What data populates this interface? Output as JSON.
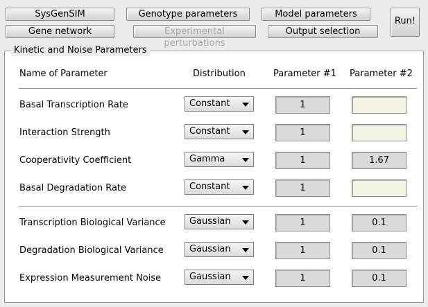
{
  "toolbar": {
    "sysgensim": "SysGenSIM",
    "genotype": "Genotype parameters",
    "model": "Model parameters",
    "gene_network": "Gene network",
    "experimental": "Experimental perturbations",
    "output": "Output selection",
    "run": "Run!"
  },
  "panel": {
    "title": "Kinetic and Noise Parameters",
    "headers": {
      "name": "Name of Parameter",
      "distribution": "Distribution",
      "param1": "Parameter #1",
      "param2": "Parameter #2"
    },
    "rows": [
      {
        "name": "Basal Transcription Rate",
        "distribution": "Constant",
        "p1": "1",
        "p2": ""
      },
      {
        "name": "Interaction Strength",
        "distribution": "Constant",
        "p1": "1",
        "p2": ""
      },
      {
        "name": "Cooperativity Coefficient",
        "distribution": "Gamma",
        "p1": "1",
        "p2": "1.67"
      },
      {
        "name": "Basal Degradation Rate",
        "distribution": "Constant",
        "p1": "1",
        "p2": ""
      },
      {
        "name": "Transcription Biological Variance",
        "distribution": "Gaussian",
        "p1": "1",
        "p2": "0.1"
      },
      {
        "name": "Degradation Biological Variance",
        "distribution": "Gaussian",
        "p1": "1",
        "p2": "0.1"
      },
      {
        "name": "Expression Measurement Noise",
        "distribution": "Gaussian",
        "p1": "1",
        "p2": "0.1"
      }
    ]
  }
}
